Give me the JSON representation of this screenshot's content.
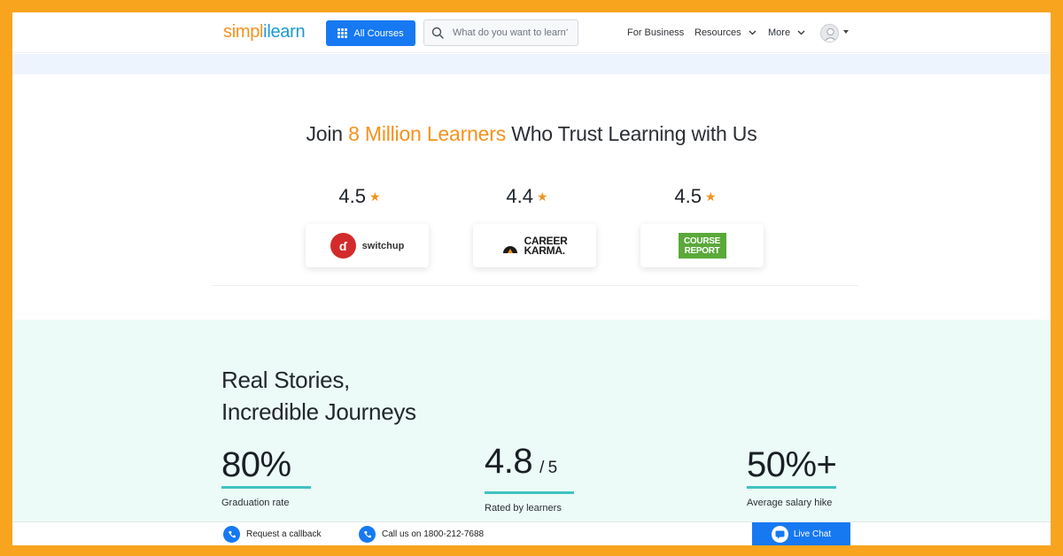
{
  "header": {
    "logo_part1": "simpl",
    "logo_sep": "i",
    "logo_part2": "learn",
    "all_courses_label": "All Courses",
    "search_placeholder": "What do you want to learn?",
    "nav": {
      "for_business": "For Business",
      "resources": "Resources",
      "more": "More"
    }
  },
  "trust": {
    "title_prefix": "Join ",
    "title_highlight": "8 Million Learners",
    "title_suffix": " Who Trust Learning with Us",
    "ratings": [
      {
        "value": "4.5",
        "platform": "switchup"
      },
      {
        "value": "4.4",
        "platform": "CAREER KARMA"
      },
      {
        "value": "4.5",
        "platform": "COURSE REPORT"
      }
    ],
    "switchup_label": "switchup",
    "ck_line1": "CAREER",
    "ck_line2": "KARMA.",
    "cr_line1": "COURSE",
    "cr_line2": "REPORT"
  },
  "stories": {
    "title_line1": "Real Stories,",
    "title_line2": "Incredible Journeys",
    "stats": [
      {
        "value": "80%",
        "suffix": "",
        "label": "Graduation rate"
      },
      {
        "value": "4.8",
        "suffix": "/ 5",
        "label": "Rated by learners"
      },
      {
        "value": "50%+",
        "suffix": "",
        "label": "Average salary hike"
      }
    ]
  },
  "bottombar": {
    "callback_label": "Request a callback",
    "call_label": "Call us on 1800-212-7688",
    "live_chat_label": "Live Chat"
  },
  "colors": {
    "frame": "#F8A41E",
    "brand_orange": "#F6921E",
    "brand_blue": "#1679F2",
    "accent_teal": "#3FC3C3",
    "stories_bg": "#ECFBF7"
  }
}
